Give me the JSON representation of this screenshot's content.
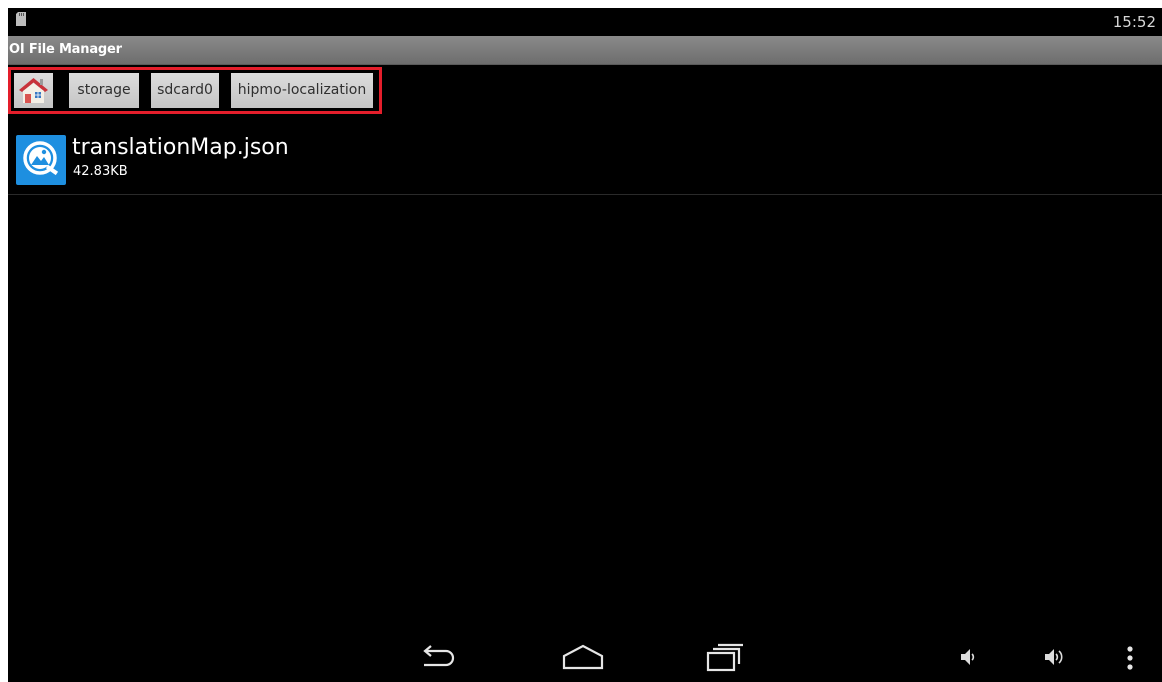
{
  "status_bar": {
    "time": "15:52",
    "left_icon": "sd-card-icon"
  },
  "app": {
    "title": "OI File Manager"
  },
  "breadcrumb": {
    "home_icon": "home-icon",
    "items": [
      {
        "label": "storage"
      },
      {
        "label": "sdcard0"
      },
      {
        "label": "hipmo-localization"
      }
    ],
    "highlight_color": "#e41e2b"
  },
  "files": [
    {
      "name": "translationMap.json",
      "size": "42.83KB",
      "icon": "image-file-icon"
    }
  ],
  "nav_bar": {
    "buttons": [
      "back-icon",
      "home-icon",
      "recent-apps-icon",
      "volume-down-icon",
      "volume-up-icon",
      "menu-icon"
    ]
  }
}
